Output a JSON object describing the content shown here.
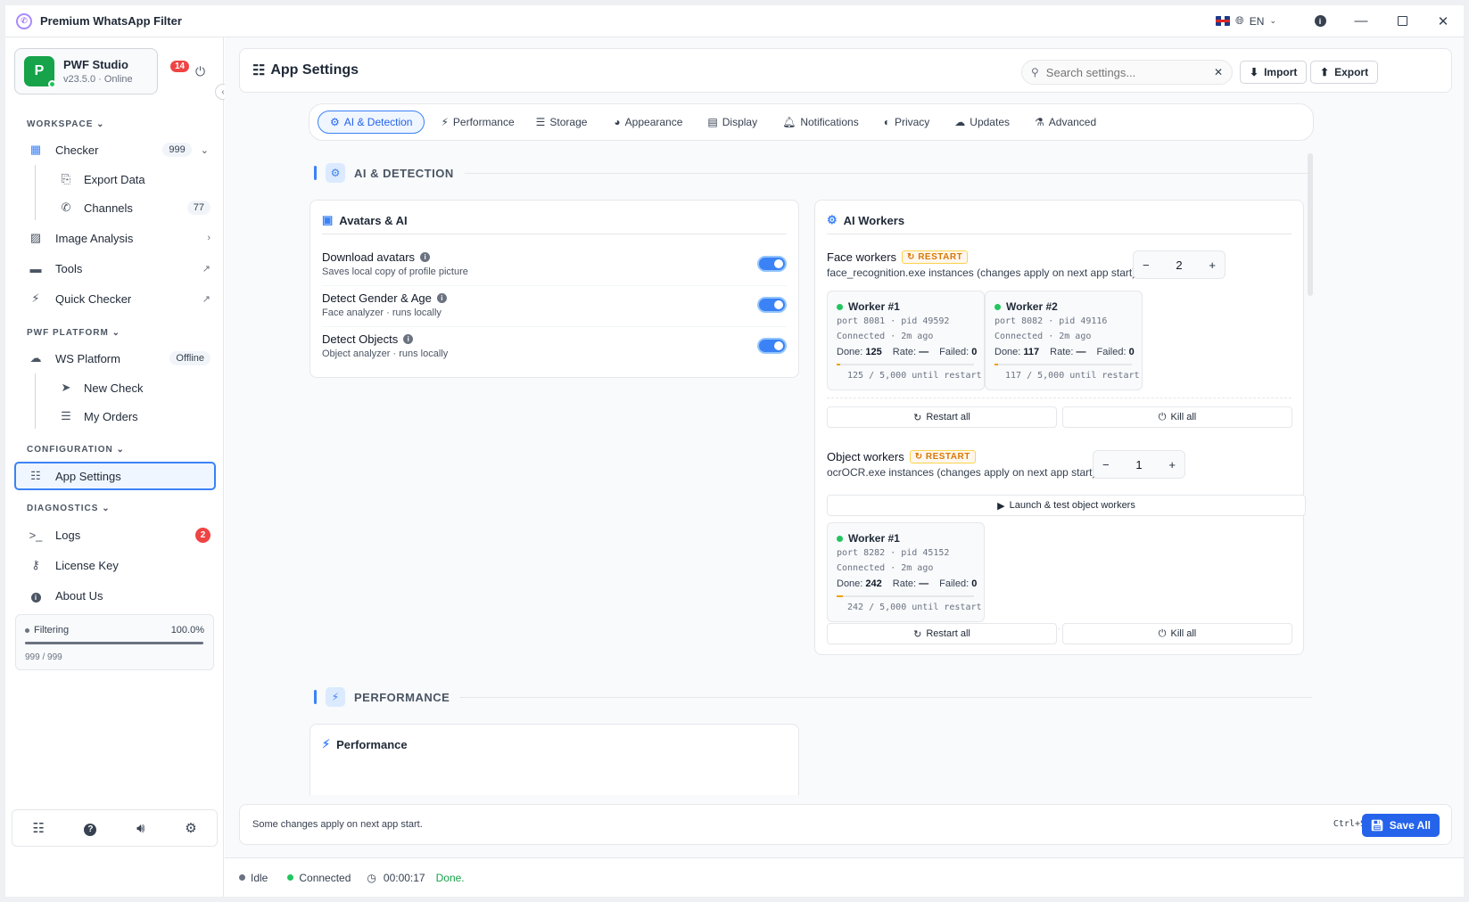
{
  "window": {
    "title": "Premium WhatsApp Filter",
    "language": "EN"
  },
  "profile": {
    "initial": "P",
    "name": "PWF Studio",
    "version": "v23.5.0 · Online",
    "notifications": "14"
  },
  "sidebar": {
    "workspace_label": "WORKSPACE",
    "platform_label": "PWF PLATFORM",
    "config_label": "CONFIGURATION",
    "diagnostics_label": "DIAGNOSTICS",
    "checker": {
      "label": "Checker",
      "count": "999"
    },
    "export_data": {
      "label": "Export Data"
    },
    "channels": {
      "label": "Channels",
      "count": "77"
    },
    "image_analysis": {
      "label": "Image Analysis"
    },
    "tools": {
      "label": "Tools"
    },
    "quick_checker": {
      "label": "Quick Checker"
    },
    "ws_platform": {
      "label": "WS Platform",
      "status": "Offline"
    },
    "new_check": {
      "label": "New Check"
    },
    "my_orders": {
      "label": "My Orders"
    },
    "app_settings": {
      "label": "App Settings"
    },
    "logs": {
      "label": "Logs",
      "count": "2"
    },
    "license_key": {
      "label": "License Key"
    },
    "about_us": {
      "label": "About Us"
    },
    "filtering": {
      "label": "Filtering",
      "percent": "100.0%",
      "progress": 1.0,
      "count": "999 / 999"
    }
  },
  "header": {
    "title": "App Settings",
    "search_placeholder": "Search settings...",
    "import_label": "Import",
    "export_label": "Export"
  },
  "tabs": [
    {
      "label": "AI & Detection"
    },
    {
      "label": "Performance"
    },
    {
      "label": "Storage"
    },
    {
      "label": "Appearance"
    },
    {
      "label": "Display"
    },
    {
      "label": "Notifications"
    },
    {
      "label": "Privacy"
    },
    {
      "label": "Updates"
    },
    {
      "label": "Advanced"
    }
  ],
  "sections": {
    "ai": "AI & DETECTION",
    "performance": "PERFORMANCE"
  },
  "avatars_card": {
    "title": "Avatars & AI",
    "rows": [
      {
        "title": "Download avatars",
        "subtitle": "Saves local copy of profile picture"
      },
      {
        "title": "Detect Gender & Age",
        "subtitle": "Face analyzer · runs locally"
      },
      {
        "title": "Detect Objects",
        "subtitle": "Object analyzer · runs locally"
      }
    ]
  },
  "workers_card": {
    "title": "AI Workers",
    "restart_badge": "RESTART",
    "face": {
      "title": "Face workers",
      "desc": "face_recognition.exe instances (changes apply on next app start)",
      "count": "2",
      "workers": [
        {
          "name": "Worker #1",
          "info": "port 8081 · pid 49592",
          "state": "Connected · 2m ago",
          "done_label": "Done:",
          "done": "125",
          "rate_label": "Rate:",
          "rate": "—",
          "failed_label": "Failed:",
          "failed": "0",
          "progress": 0.025,
          "until": "125 / 5,000 until restart"
        },
        {
          "name": "Worker #2",
          "info": "port 8082 · pid 49116",
          "state": "Connected · 2m ago",
          "done_label": "Done:",
          "done": "117",
          "rate_label": "Rate:",
          "rate": "—",
          "failed_label": "Failed:",
          "failed": "0",
          "progress": 0.0234,
          "until": "117 / 5,000 until restart"
        }
      ]
    },
    "object": {
      "title": "Object workers",
      "desc": "ocrOCR.exe instances (changes apply on next app start)",
      "count": "1",
      "launch_label": "Launch & test object workers",
      "workers": [
        {
          "name": "Worker #1",
          "info": "port 8282 · pid 45152",
          "state": "Connected · 2m ago",
          "done_label": "Done:",
          "done": "242",
          "rate_label": "Rate:",
          "rate": "—",
          "failed_label": "Failed:",
          "failed": "0",
          "progress": 0.0484,
          "until": "242 / 5,000 until restart"
        }
      ]
    },
    "restart_all": "Restart all",
    "kill_all": "Kill all"
  },
  "performance_card": {
    "title": "Performance"
  },
  "footer": {
    "note": "Some changes apply on next app start.",
    "shortcut": "Ctrl+S",
    "save_label": "Save All"
  },
  "status": {
    "state": "Idle",
    "connection": "Connected",
    "timer": "00:00:17",
    "message": "Done."
  }
}
